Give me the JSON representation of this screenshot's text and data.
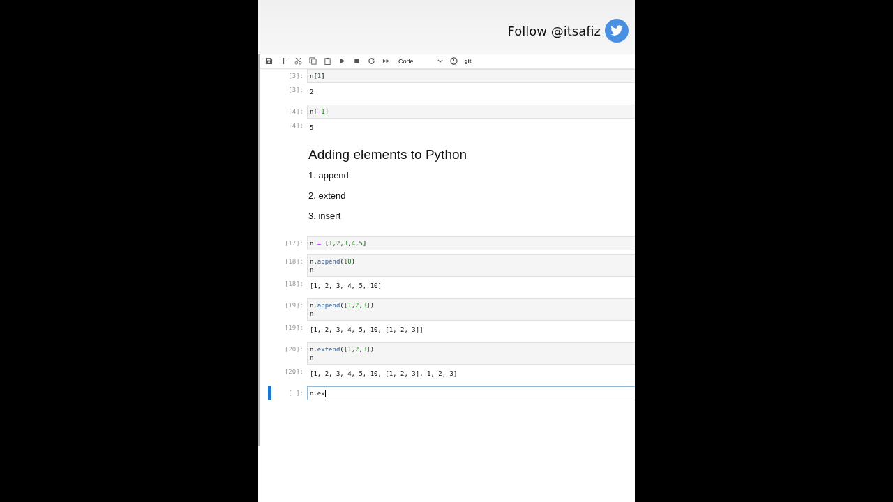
{
  "banner": {
    "text": "Follow @itsafiz"
  },
  "toolbar": {
    "cell_type": "Code",
    "git": "git"
  },
  "cells": [
    {
      "kind": "input",
      "prompt": "[3]:",
      "lines": [
        [
          {
            "text": "n",
            "kind": "t"
          },
          {
            "text": "[",
            "kind": "p"
          },
          {
            "text": "1",
            "kind": "n"
          },
          {
            "text": "]",
            "kind": "p"
          }
        ]
      ]
    },
    {
      "kind": "output",
      "prompt": "[3]:",
      "lines": [
        "2"
      ]
    },
    {
      "kind": "input",
      "prompt": "[4]:",
      "lines": [
        [
          {
            "text": "n",
            "kind": "t"
          },
          {
            "text": "[",
            "kind": "p"
          },
          {
            "text": "-",
            "kind": "o"
          },
          {
            "text": "1",
            "kind": "n"
          },
          {
            "text": "]",
            "kind": "p"
          }
        ]
      ]
    },
    {
      "kind": "output",
      "prompt": "[4]:",
      "lines": [
        "5"
      ]
    },
    {
      "kind": "markdown",
      "heading": "Adding elements to Python",
      "items": [
        "1. append",
        "2. extend",
        "3. insert"
      ]
    },
    {
      "kind": "input",
      "prompt": "[17]:",
      "lines": [
        [
          {
            "text": "n ",
            "kind": "t"
          },
          {
            "text": "=",
            "kind": "o"
          },
          {
            "text": " [",
            "kind": "p"
          },
          {
            "text": "1",
            "kind": "n"
          },
          {
            "text": ",",
            "kind": "p"
          },
          {
            "text": "2",
            "kind": "n"
          },
          {
            "text": ",",
            "kind": "p"
          },
          {
            "text": "3",
            "kind": "n"
          },
          {
            "text": ",",
            "kind": "p"
          },
          {
            "text": "4",
            "kind": "n"
          },
          {
            "text": ",",
            "kind": "p"
          },
          {
            "text": "5",
            "kind": "n"
          },
          {
            "text": "]",
            "kind": "p"
          }
        ]
      ]
    },
    {
      "kind": "input",
      "prompt": "[18]:",
      "lines": [
        [
          {
            "text": "n.",
            "kind": "t"
          },
          {
            "text": "append",
            "kind": "f"
          },
          {
            "text": "(",
            "kind": "p"
          },
          {
            "text": "10",
            "kind": "n"
          },
          {
            "text": ")",
            "kind": "p"
          }
        ],
        [
          {
            "text": "n",
            "kind": "t"
          }
        ]
      ]
    },
    {
      "kind": "output",
      "prompt": "[18]:",
      "lines": [
        "[1, 2, 3, 4, 5, 10]"
      ]
    },
    {
      "kind": "input",
      "prompt": "[19]:",
      "lines": [
        [
          {
            "text": "n.",
            "kind": "t"
          },
          {
            "text": "append",
            "kind": "f"
          },
          {
            "text": "([",
            "kind": "p"
          },
          {
            "text": "1",
            "kind": "n"
          },
          {
            "text": ",",
            "kind": "p"
          },
          {
            "text": "2",
            "kind": "n"
          },
          {
            "text": ",",
            "kind": "p"
          },
          {
            "text": "3",
            "kind": "n"
          },
          {
            "text": "])",
            "kind": "p"
          }
        ],
        [
          {
            "text": "n",
            "kind": "t"
          }
        ]
      ]
    },
    {
      "kind": "output",
      "prompt": "[19]:",
      "lines": [
        "[1, 2, 3, 4, 5, 10, [1, 2, 3]]"
      ]
    },
    {
      "kind": "input",
      "prompt": "[20]:",
      "lines": [
        [
          {
            "text": "n.",
            "kind": "t"
          },
          {
            "text": "extend",
            "kind": "f"
          },
          {
            "text": "([",
            "kind": "p"
          },
          {
            "text": "1",
            "kind": "n"
          },
          {
            "text": ",",
            "kind": "p"
          },
          {
            "text": "2",
            "kind": "n"
          },
          {
            "text": ",",
            "kind": "p"
          },
          {
            "text": "3",
            "kind": "n"
          },
          {
            "text": "])",
            "kind": "p"
          }
        ],
        [
          {
            "text": "n",
            "kind": "t"
          }
        ]
      ]
    },
    {
      "kind": "output",
      "prompt": "[20]:",
      "lines": [
        "[1, 2, 3, 4, 5, 10, [1, 2, 3], 1, 2, 3]"
      ]
    },
    {
      "kind": "input",
      "prompt": "[ ]:",
      "active": true,
      "lines": [
        [
          {
            "text": "n.ex",
            "kind": "t"
          }
        ]
      ]
    }
  ]
}
